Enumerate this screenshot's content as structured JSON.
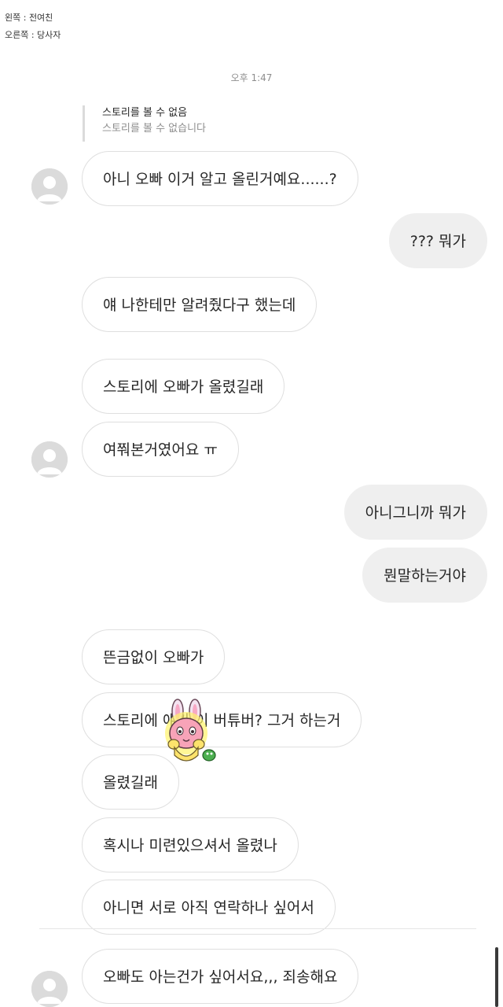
{
  "captions": {
    "left_label": "왼쪽 : 전여친",
    "right_label": "오른쪽 : 당사자"
  },
  "chat": {
    "timestamp": "오후 1:47",
    "story_reply": {
      "title": "스토리를 볼 수 없음",
      "subtitle": "스토리를 볼 수 없습니다"
    },
    "messages": [
      {
        "side": "left",
        "text": "아니 오빠 이거 알고 올린거예요......?"
      },
      {
        "side": "right",
        "text": "??? 뭐가"
      },
      {
        "side": "left",
        "text": "얘 나한테만 알려줬다구 했는데"
      },
      {
        "side": "left",
        "text": "스토리에 오빠가 올렸길래"
      },
      {
        "side": "left",
        "text": "여쭤본거였어요 ㅠ"
      },
      {
        "side": "right",
        "text": "아니그니까 뭐가"
      },
      {
        "side": "right",
        "text": "뭔말하는거야"
      },
      {
        "side": "left",
        "text": "뜬금없이 오빠가"
      },
      {
        "side": "left",
        "text": "스토리에 얘가 이 버튜버? 그거 하는거"
      },
      {
        "side": "left",
        "text": "올렸길래"
      },
      {
        "side": "left",
        "text": "혹시나 미련있으셔서 올렸나"
      },
      {
        "side": "left",
        "text": "아니면 서로 아직 연락하나 싶어서"
      },
      {
        "side": "left",
        "text": "오빠도 아는건가 싶어서요,,, 죄송해요"
      }
    ]
  },
  "icons": {
    "avatar": "default-profile-avatar-icon",
    "sticker": "rabbit-character-sticker-icon"
  },
  "colors": {
    "received_bubble_border": "#dfdfdf",
    "sent_bubble_bg": "#efefef",
    "timestamp": "#8e8e8e",
    "avatar_bg": "#dbdbdb"
  }
}
